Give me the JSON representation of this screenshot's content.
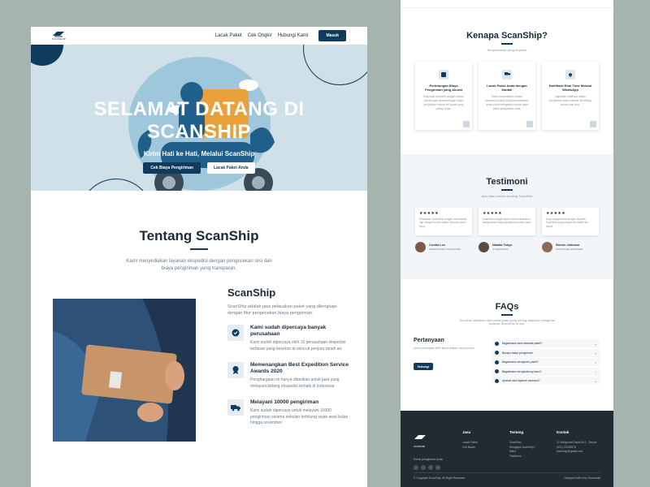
{
  "brand": {
    "logo_text": "SCANSHIP"
  },
  "nav": {
    "links": [
      "Lacak Paket",
      "Cek Ongkir",
      "Hubungi Kami"
    ],
    "login": "Masuk"
  },
  "hero": {
    "title_line1": "SELAMAT DATANG DI",
    "title_line2": "SCANSHIP",
    "subtitle": "Kirim Hati ke Hati, Melalui ScanShip",
    "btn_primary": "Cek Biaya Pengiriman",
    "btn_secondary": "Lacak Paket Anda"
  },
  "about": {
    "title": "Tentang ScanShip",
    "desc": "Kami menyediakan layanan ekspedisi dengan pengecekan resi dan biaya pengiriman yang transparan.",
    "brand_heading": "ScanShip",
    "lead": "ScanShip adalah jasa pelacakan paket yang dilengkapi dengan fitur pengecekan biaya pengiriman.",
    "features": [
      {
        "title": "Kami sudah dipercaya banyak perusahaan",
        "text": "Kami sudah dipercaya oleh 15 perusahaan ekspedisi terbesar yang tersebar di seluruh penjuru tanah air."
      },
      {
        "title": "Memenangkan Best Expedition Service Awards 2020",
        "text": "Penghargaan ini hanya diberikan untuk jasa yang melayani bidang ekspedisi terbaik di Indonesia"
      },
      {
        "title": "Melayani 10000 pengiriman",
        "text": "Kami sudah dipercaya untuk melayani 10000 pengiriman selama sebulan terhitung sejak awal bulan hingga november."
      }
    ]
  },
  "why": {
    "title": "Kenapa ScanShip?",
    "subtitle": "Kenyamanan yang terjamin",
    "cards": [
      {
        "title": "Perhitungan Biaya Pengiriman yang Akurat",
        "text": "Ekspedisi otomatis dengan sistem perhitungan akurat dengan biaya pengiriman murah ke tujuan yang paling cepat."
      },
      {
        "title": "Lacak Paket Anda dengan Mudah",
        "text": "Kami menyediakan sistem pelacakan paket yang memudahkan anda untuk mengetahui posisi pasti paket pengiriman anda."
      },
      {
        "title": "Notifikasi Real Time Melalui WhatsApp",
        "text": "Dapatkan notifikasi status pengiriman paket melalui WhatsApp secara real time."
      }
    ]
  },
  "testimoni": {
    "title": "Testimoni",
    "subtitle": "Apa kata mereka tentang ScanShip",
    "stars": "★★★★★",
    "items": [
      {
        "text": "Pelayanan ScanShip sangat memuaskan dan sangat mudah dalam melacak paket saya.",
        "name": "Cecilia Lee",
        "role": "FREELANCER SINGAPORE"
      },
      {
        "text": "ScanShip sangat cepat dalam melakukan pengecekan biaya pengiriman paket saya.",
        "name": "Nakata Tokyo",
        "role": "UI DESIGNER"
      },
      {
        "text": "Saya sangat suka dengan layanan ScanShip yang sangat informatif dan cepat.",
        "name": "Steven Johnson",
        "role": "SOFTWARE ENGINEER"
      }
    ]
  },
  "faqs": {
    "title": "FAQs",
    "subtitle": "Temukan jawaban dari pertanyaan yang sering diajukan mengenai layanan ScanShip di sini.",
    "left_title": "Pertanyaan",
    "left_text": "Untuk pertanyaan lebih lanjut silakan hubungi kami.",
    "left_btn": "Hubungi",
    "questions": [
      "Bagaimana cara melacak paket?",
      "Berapa biaya pengiriman",
      "Bagaimana mengecek paket?",
      "Bagaimana menghubungi kami?",
      "Apakah ada layanan asuransi?"
    ]
  },
  "footer": {
    "tagline": "Solusi pengiriman Anda",
    "col1_title": "Jasa",
    "col1_items": [
      "Lacak Paket",
      "Cek Biaya"
    ],
    "col2_title": "Tentang",
    "col2_items": [
      "ScanShip",
      "Mengapa ScanShip?",
      "Mitra",
      "Testimoni"
    ],
    "col3_title": "Kontak",
    "col3_items": [
      "Jl. Margonda Raya No.1 - Depok",
      "(021) 22435678",
      "scanship@gmail.com"
    ],
    "copyright": "© Copyright ScanShip. All Right Reserved",
    "credit": "Designed with ♥ by Mooncraft"
  },
  "colors": {
    "primary": "#0f3c5c",
    "hero_bg": "#cfe0e8",
    "footer_bg": "#222b33"
  }
}
